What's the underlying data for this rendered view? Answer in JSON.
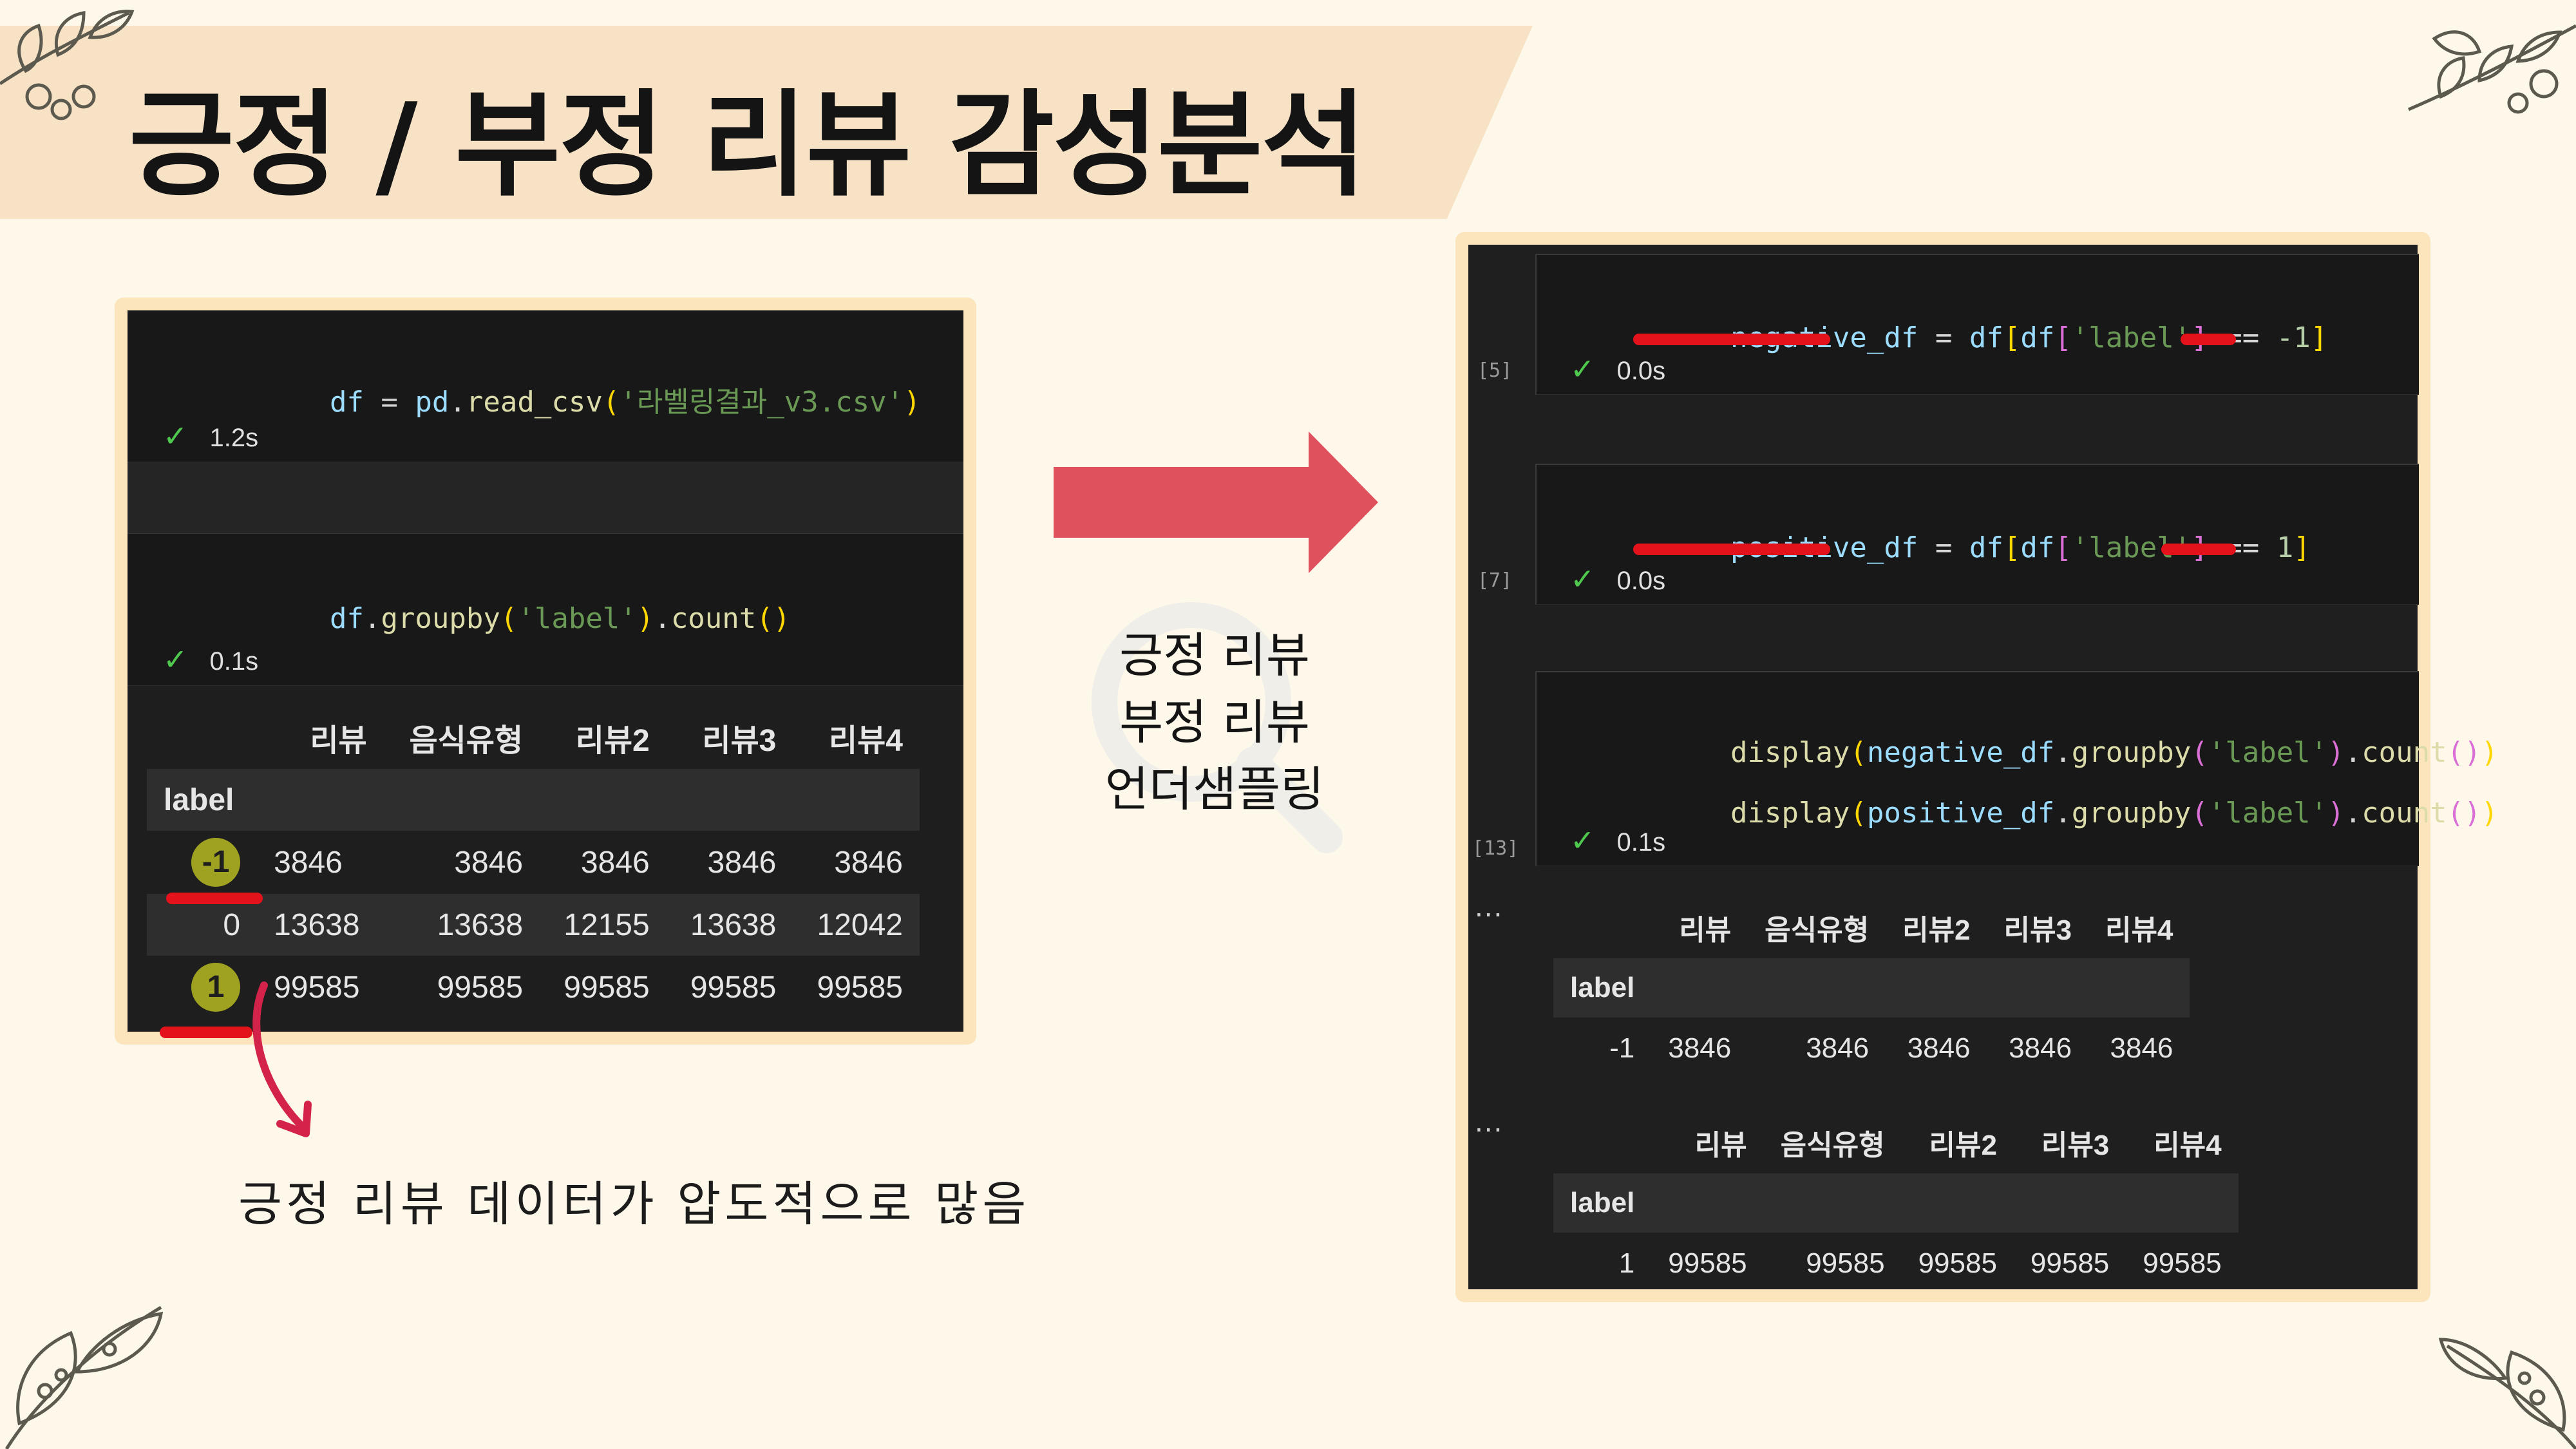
{
  "slide": {
    "title": "긍정 / 부정 리뷰 감성분석",
    "side_text": [
      "긍정 리뷰",
      "부정 리뷰",
      "언더샘플링"
    ],
    "note": "긍정 리뷰 데이터가 압도적으로 많음"
  },
  "colors": {
    "background": "#fdf8ea",
    "title_band": "#f8e2c6",
    "arrow": "#e0515e",
    "highlight_underline": "#e3121b",
    "notebook_bg": "#1e1e1e"
  },
  "left_notebook": {
    "cell1": {
      "tokens": [
        "df",
        " = ",
        "pd",
        ".",
        "read_csv",
        "(",
        "'라벨링결과_v3.csv'",
        ")"
      ],
      "time": "1.2s"
    },
    "cell2": {
      "tokens": [
        "df",
        ".",
        "groupby",
        "(",
        "'label'",
        ")",
        ".",
        "count",
        "()"
      ],
      "time": "0.1s"
    },
    "table": {
      "columns": [
        "리뷰",
        "음식유형",
        "리뷰2",
        "리뷰3",
        "리뷰4"
      ],
      "index_name": "label",
      "rows": [
        {
          "label": "-1",
          "values": [
            "3846",
            "3846",
            "3846",
            "3846",
            "3846"
          ]
        },
        {
          "label": "0",
          "values": [
            "13638",
            "13638",
            "12155",
            "13638",
            "12042"
          ]
        },
        {
          "label": "1",
          "values": [
            "99585",
            "99585",
            "99585",
            "99585",
            "99585"
          ]
        }
      ]
    }
  },
  "right_notebook": {
    "cell5": {
      "prompt": "[5]",
      "tokens": [
        "negative_df",
        " = ",
        "df",
        "[",
        "df",
        "[",
        "'label'",
        "]",
        " == ",
        "-1",
        "]"
      ],
      "time": "0.0s"
    },
    "cell7": {
      "prompt": "[7]",
      "tokens": [
        "positive_df",
        " = ",
        "df",
        "[",
        "df",
        "[",
        "'label'",
        "]",
        " == ",
        "1",
        "]"
      ],
      "time": "0.0s"
    },
    "cell13": {
      "prompt": "[13]",
      "line1": [
        "display",
        "(",
        "negative_df",
        ".",
        "groupby",
        "(",
        "'label'",
        ")",
        ".",
        "count",
        "()",
        ")"
      ],
      "line2": [
        "display",
        "(",
        "positive_df",
        ".",
        "groupby",
        "(",
        "'label'",
        ")",
        ".",
        "count",
        "()",
        ")"
      ],
      "time": "0.1s"
    },
    "output_dots": "...",
    "table_neg": {
      "columns": [
        "리뷰",
        "음식유형",
        "리뷰2",
        "리뷰3",
        "리뷰4"
      ],
      "index_name": "label",
      "rows": [
        {
          "label": "-1",
          "values": [
            "3846",
            "3846",
            "3846",
            "3846",
            "3846"
          ]
        }
      ]
    },
    "table_pos": {
      "columns": [
        "리뷰",
        "음식유형",
        "리뷰2",
        "리뷰3",
        "리뷰4"
      ],
      "index_name": "label",
      "rows": [
        {
          "label": "1",
          "values": [
            "99585",
            "99585",
            "99585",
            "99585",
            "99585"
          ]
        }
      ]
    }
  },
  "icons": {
    "checkmark": "check-icon",
    "arrow": "right-arrow-icon",
    "curved_arrow": "curved-arrow-icon",
    "leaf": "leaf-decoration-icon"
  }
}
